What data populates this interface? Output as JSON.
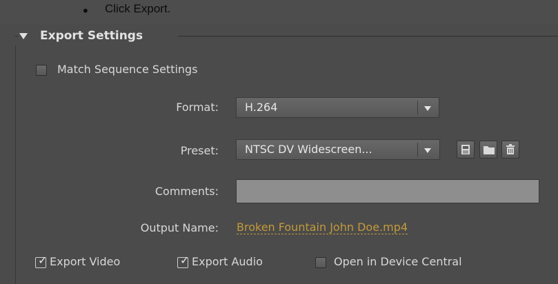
{
  "instruction": {
    "bullet": "•",
    "text": "Click Export."
  },
  "section": {
    "title": "Export Settings"
  },
  "match_sequence": {
    "label": "Match Sequence Settings",
    "checked": false
  },
  "format": {
    "label": "Format:",
    "value": "H.264"
  },
  "preset": {
    "label": "Preset:",
    "value": "NTSC DV Widescreen..."
  },
  "preset_icons": [
    "save-preset-icon",
    "import-preset-icon",
    "delete-preset-icon"
  ],
  "comments": {
    "label": "Comments:",
    "value": ""
  },
  "output": {
    "label": "Output Name:",
    "value": "Broken Fountain John Doe.mp4"
  },
  "export_video": {
    "label": "Export Video",
    "checked": true
  },
  "export_audio": {
    "label": "Export Audio",
    "checked": true
  },
  "device_central": {
    "label": "Open in Device Central",
    "checked": false
  },
  "colors": {
    "panel_bg": "#4b4b4b",
    "link": "#c39a3a",
    "text": "#d8d8d8"
  }
}
